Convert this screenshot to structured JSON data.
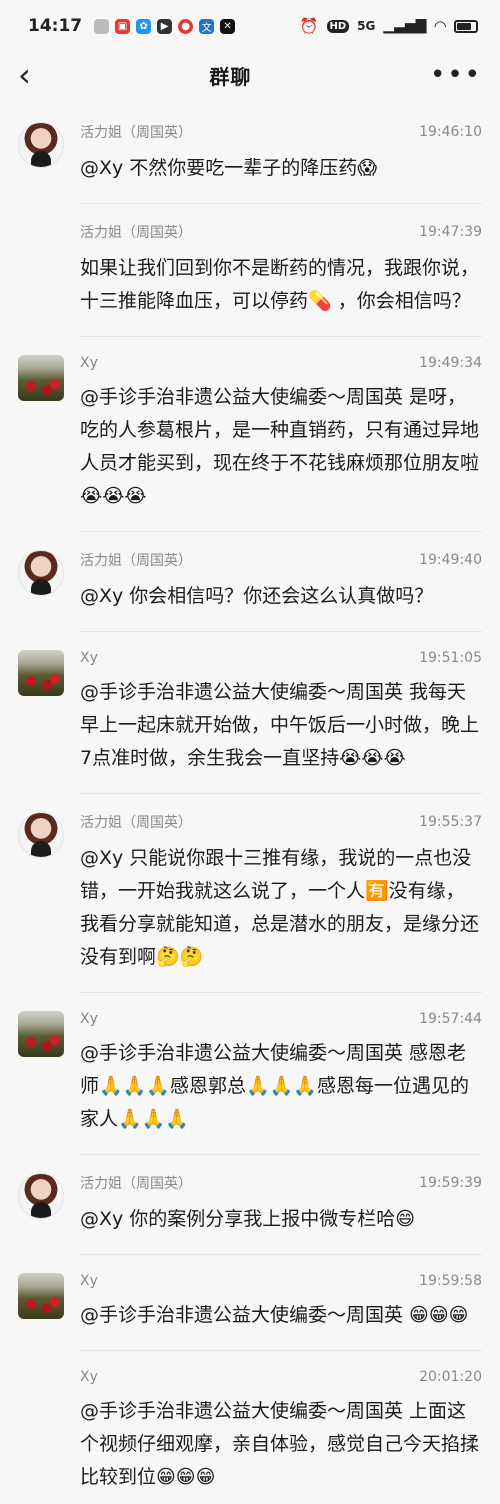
{
  "status_bar": {
    "time": "14:17",
    "network": "5G",
    "hd": "HD"
  },
  "header": {
    "title": "群聊"
  },
  "messages": [
    {
      "sender": "活力姐（周国英）",
      "time": "19:46:10",
      "text": "@Xy 不然你要吃一辈子的降压药😱",
      "avatar": "female"
    },
    {
      "sender": "活力姐（周国英）",
      "time": "19:47:39",
      "text": "如果让我们回到你不是断药的情况，我跟你说，十三推能降血压，可以停药💊 ，你会相信吗？",
      "avatar": "none"
    },
    {
      "sender": "Xy",
      "time": "19:49:34",
      "text": "@手诊手治非遗公益大使编委～周国英 是呀，吃的人参葛根片，是一种直销药，只有通过异地人员才能买到，现在终于不花钱麻烦那位朋友啦😭😭😭",
      "avatar": "xy"
    },
    {
      "sender": "活力姐（周国英）",
      "time": "19:49:40",
      "text": "@Xy 你会相信吗？你还会这么认真做吗？",
      "avatar": "female"
    },
    {
      "sender": "Xy",
      "time": "19:51:05",
      "text": "@手诊手治非遗公益大使编委～周国英 我每天早上一起床就开始做，中午饭后一小时做，晚上7点准时做，余生我会一直坚持😭😭😭",
      "avatar": "xy"
    },
    {
      "sender": "活力姐（周国英）",
      "time": "19:55:37",
      "text": "@Xy 只能说你跟十三推有缘，我说的一点也没错，一开始我就这么说了，一个人🈶没有缘，我看分享就能知道，总是潜水的朋友，是缘分还没有到啊🤔🤔",
      "avatar": "female"
    },
    {
      "sender": "Xy",
      "time": "19:57:44",
      "text": "@手诊手治非遗公益大使编委～周国英 感恩老师🙏🙏🙏感恩郭总🙏🙏🙏感恩每一位遇见的家人🙏🙏🙏",
      "avatar": "xy"
    },
    {
      "sender": "活力姐（周国英）",
      "time": "19:59:39",
      "text": "@Xy 你的案例分享我上报中微专栏哈😄",
      "avatar": "female"
    },
    {
      "sender": "Xy",
      "time": "19:59:58",
      "text": "@手诊手治非遗公益大使编委～周国英 😁😁😁",
      "avatar": "xy"
    },
    {
      "sender": "Xy",
      "time": "20:01:20",
      "text": "@手诊手治非遗公益大使编委～周国英 上面这个视频仔细观摩，亲自体验，感觉自己今天掐揉比较到位😁😁😁",
      "avatar": "none"
    }
  ]
}
